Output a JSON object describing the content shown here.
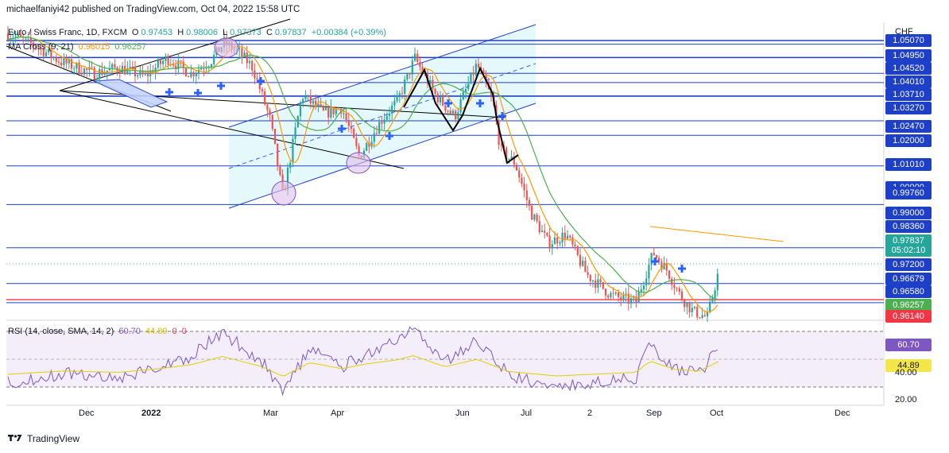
{
  "header": {
    "publisher_line": "michaelfaniyi42 published on TradingView.com, Oct 04, 2022 15:58 UTC"
  },
  "legend": {
    "symbol": "Euro / Swiss Franc, 1D, FXCM",
    "open_label": "O",
    "open": "0.97453",
    "high_label": "H",
    "high": "0.98006",
    "low_label": "L",
    "low": "0.97373",
    "close_label": "C",
    "close": "0.97837",
    "change": "+0.00384 (+0.39%)",
    "ma_name": "MA Cross (9, 21)",
    "ma_fast": "0.96015",
    "ma_slow": "0.96257",
    "rsi_name": "RSI (14, close, SMA, 14, 2)",
    "rsi_value": "60.70",
    "rsi_ma": "44.89",
    "rsi_extra1": "0",
    "rsi_extra2": "0"
  },
  "price_axis": {
    "currency": "CHF",
    "labels": [
      {
        "text": "1.05070",
        "style": "blue"
      },
      {
        "text": "1.04950",
        "style": "blue"
      },
      {
        "text": "1.04520",
        "style": "plain"
      },
      {
        "text": "1.04010",
        "style": "plain"
      },
      {
        "text": "1.03710",
        "style": "plain"
      },
      {
        "text": "1.03270",
        "style": "plain"
      },
      {
        "text": "1.02470",
        "style": "plain"
      },
      {
        "text": "1.02000",
        "style": "plain"
      },
      {
        "text": "1.01010",
        "style": "plain"
      },
      {
        "text": "1.00000",
        "style": "plain"
      },
      {
        "text": "0.99760",
        "style": "blue"
      },
      {
        "text": "0.99000",
        "style": "plain"
      },
      {
        "text": "0.98360",
        "style": "plain"
      },
      {
        "text": "0.97837",
        "style": "green"
      },
      {
        "text": "05:02:10",
        "style": "green"
      },
      {
        "text": "0.97200",
        "style": "plain"
      },
      {
        "text": "0.96679",
        "style": "plain"
      },
      {
        "text": "0.96580",
        "style": "plain"
      },
      {
        "text": "0.96257",
        "style": "darkgreen"
      },
      {
        "text": "0.96140",
        "style": "red"
      }
    ]
  },
  "rsi_axis": {
    "value_tag": "60.70",
    "ma_tag": "44.89",
    "level_40": "40.00",
    "level_20": "20.00"
  },
  "time_axis": [
    "Dec",
    "2022",
    "Mar",
    "Apr",
    "Jun",
    "Jul",
    "2",
    "Sep",
    "Oct",
    "Dec"
  ],
  "footer": {
    "brand": "TradingView"
  },
  "colors": {
    "up": "#26a69a",
    "down": "#ef5350",
    "ma_fast": "#ff9800",
    "ma_slow": "#4caf50",
    "level_line": "#2962ff",
    "red_level": "#f23645",
    "rsi": "#7e57c2",
    "rsi_ma": "#e0d000",
    "pattern": "#000000",
    "channel_fill": "#e0f7fa"
  },
  "chart_data": {
    "type": "candlestick",
    "symbol": "Euro / Swiss Franc, 1D, FXCM",
    "last": {
      "open": 0.97453,
      "high": 0.98006,
      "low": 0.97373,
      "close": 0.97837,
      "change": 0.00384,
      "change_pct": 0.39
    },
    "horizontal_levels": [
      1.0507,
      1.0495,
      1.0452,
      1.0401,
      1.0371,
      1.0327,
      1.0247,
      1.02,
      1.0101,
      0.9976,
      0.9836,
      0.972,
      0.96679,
      0.9658
    ],
    "price_range": [
      0.96,
      1.053
    ],
    "rsi_levels": [
      70,
      30
    ]
  }
}
